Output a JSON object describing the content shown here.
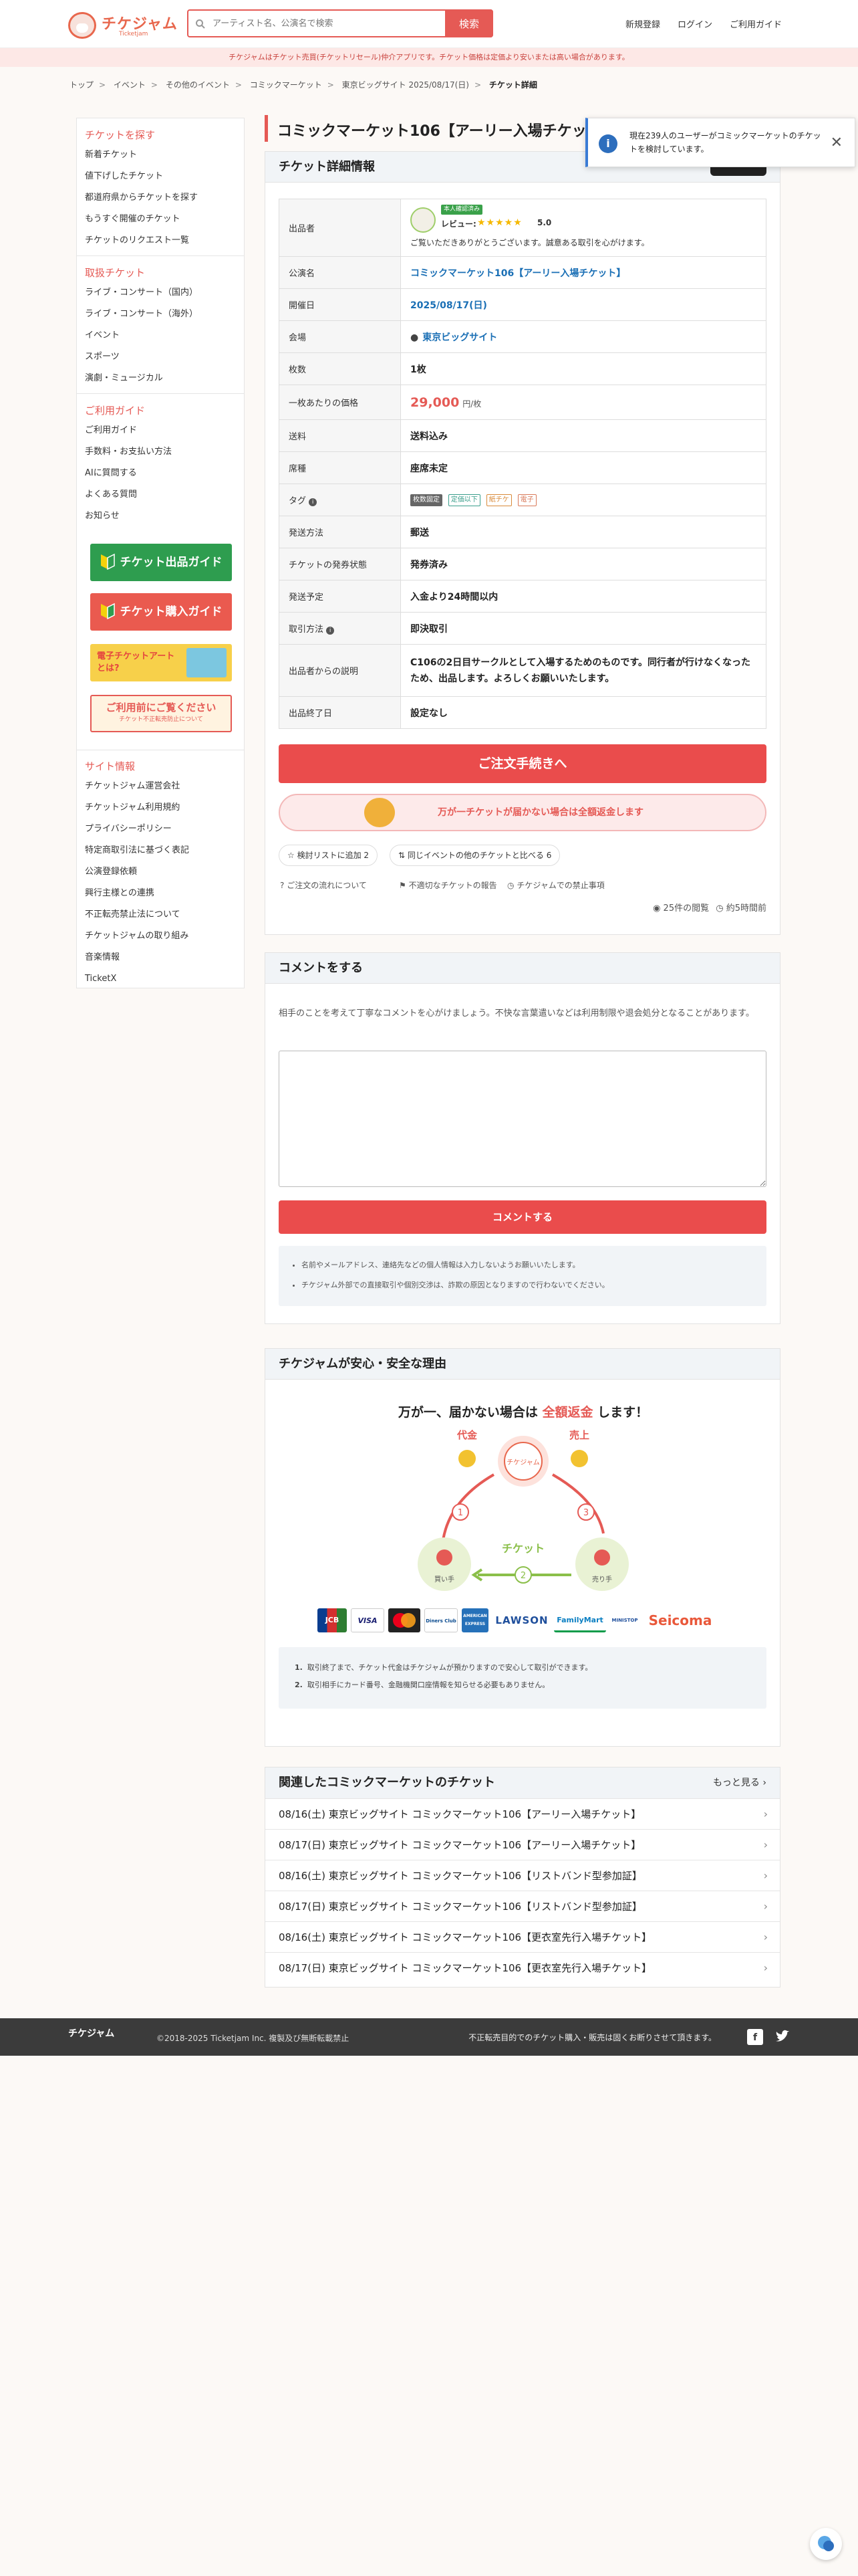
{
  "header": {
    "logo_text": "チケジャム",
    "logo_sub": "Ticketjam",
    "search_placeholder": "アーティスト名、公演名で検索",
    "search_button": "検索",
    "nav": [
      "新規登録",
      "ログイン",
      "ご利用ガイド"
    ]
  },
  "notice": "チケジャムはチケット売買(チケットリセール)仲介アプリです。チケット価格は定価より安いまたは高い場合があります。",
  "breadcrumb": [
    "トップ",
    "イベント",
    "その他のイベント",
    "コミックマーケット",
    "東京ビッグサイト 2025/08/17(日)",
    "チケット詳細"
  ],
  "sidebar": {
    "find_head": "チケットを探す",
    "find_items": [
      "新着チケット",
      "値下げしたチケット",
      "都道府県からチケットを探す",
      "もうすぐ開催のチケット",
      "チケットのリクエスト一覧"
    ],
    "genre_head": "取扱チケット",
    "genre_items": [
      "ライブ・コンサート（国内）",
      "ライブ・コンサート（海外）",
      "イベント",
      "スポーツ",
      "演劇・ミュージカル"
    ],
    "guide_head": "ご利用ガイド",
    "guide_items": [
      "ご利用ガイド",
      "手数料・お支払い方法",
      "AIに質問する",
      "よくある質問",
      "お知らせ"
    ],
    "banners": [
      "チケット出品ガイド",
      "チケット購入ガイド",
      "電子チケットアートとは?",
      "ご利用前にご覧ください",
      "チケット不正転売防止について"
    ],
    "site_head": "サイト情報",
    "site_items": [
      "チケットジャム運営会社",
      "チケットジャム利用規約",
      "プライバシーポリシー",
      "特定商取引法に基づく表記",
      "公演登録依頼",
      "興行主様との連携",
      "不正転売禁止法について",
      "チケットジャムの取り組み",
      "音楽情報",
      "TicketX"
    ]
  },
  "page_title": "コミックマーケット106【アーリー入場チケット】",
  "popup": {
    "text": "現在239人のユーザーがコミックマーケットのチケットを検討しています。"
  },
  "detail": {
    "head": "チケット詳細情報",
    "seller_badge": "本人確認済み",
    "review_label": "レビュー:",
    "stars": "★★★★★",
    "rating": "5.0",
    "seller_msg": "ご覧いただきありがとうございます。誠意ある取引を心がけます。",
    "rows": [
      {
        "k": "出品者"
      },
      {
        "k": "公演名",
        "v": "コミックマーケット106【アーリー入場チケット】"
      },
      {
        "k": "開催日",
        "v": "2025/08/17(日)"
      },
      {
        "k": "会場",
        "v": "東京ビッグサイト"
      },
      {
        "k": "枚数",
        "v": "1枚"
      },
      {
        "k": "一枚あたりの価格",
        "v": "29,000",
        "unit": "円/枚"
      },
      {
        "k": "送料",
        "v": "送料込み"
      },
      {
        "k": "席種",
        "v": "座席未定"
      },
      {
        "k": "タグ",
        "tags": [
          "枚数固定",
          "定価以下",
          "紙チケ",
          "電子"
        ]
      },
      {
        "k": "発送方法",
        "v": "郵送"
      },
      {
        "k": "チケットの発券状態",
        "v": "発券済み"
      },
      {
        "k": "発送予定",
        "v": "入金より24時間以内"
      },
      {
        "k": "取引方法",
        "v": "即決取引"
      },
      {
        "k": "出品者からの説明",
        "v": "C106の2日目サークルとして入場するためのものです。同行者が行けなくなったため、出品します。よろしくお願いいたします。"
      },
      {
        "k": "出品終了日",
        "v": "設定なし"
      }
    ],
    "order_button": "ご注文手続きへ",
    "guarantee": "万が一チケットが届かない場合は全額返金します",
    "watch_button": "検討リストに追加 2",
    "compare_button": "同じイベントの他のチケットと比べる 6",
    "links": [
      "ご注文の流れについて",
      "不適切なチケットの報告",
      "チケジャムでの禁止事項"
    ],
    "views": "25件の閲覧",
    "posted": "約5時間前"
  },
  "comment": {
    "head": "コメントをする",
    "lead": "相手のことを考えて丁寧なコメントを心がけましょう。不快な言葉遣いなどは利用制限や退会処分となることがあります。",
    "button": "コメントする",
    "notes": [
      "名前やメールアドレス、連絡先などの個人情報は入力しないようお願いいたします。",
      "チケジャム外部での直接取引や個別交渉は、詐欺の原因となりますので行わないでください。"
    ]
  },
  "safety": {
    "head": "チケジャムが安心・安全な理由",
    "title_pre": "万が一、届かない場合は",
    "title_red": "全額返金",
    "title_post": "します！",
    "daikin": "代金",
    "uriage": "売上",
    "ticket": "チケット",
    "buyer": "買い手",
    "seller": "売り手",
    "payment_logos": [
      "JCB",
      "VISA",
      "Mastercard",
      "Diners Club",
      "AMERICAN EXPRESS",
      "LAWSON",
      "FamilyMart",
      "MINISTOP",
      "Seicoma"
    ],
    "notes": [
      "取引終了まで、チケット代金はチケジャムが預かりますので安心して取引ができます。",
      "取引相手にカード番号、金融機関口座情報を知らせる必要もありません。"
    ]
  },
  "related": {
    "head": "関連したコミックマーケットのチケット",
    "more": "もっと見る",
    "items": [
      "08/16(土) 東京ビッグサイト コミックマーケット106【アーリー入場チケット】",
      "08/17(日) 東京ビッグサイト コミックマーケット106【アーリー入場チケット】",
      "08/16(土) 東京ビッグサイト コミックマーケット106【リストバンド型参加証】",
      "08/17(日) 東京ビッグサイト コミックマーケット106【リストバンド型参加証】",
      "08/16(土) 東京ビッグサイト コミックマーケット106【更衣室先行入場チケット】",
      "08/17(日) 東京ビッグサイト コミックマーケット106【更衣室先行入場チケット】"
    ]
  },
  "footer": {
    "logo": "チケジャム",
    "copyright": "©2018-2025 Ticketjam Inc. 複製及び無断転載禁止",
    "warning": "不正転売目的でのチケット購入・販売は固くお断りさせて頂きます。"
  },
  "colors": {
    "accent": "#e55a55",
    "link": "#1a6fb5",
    "footer": "#3b3b3b"
  }
}
